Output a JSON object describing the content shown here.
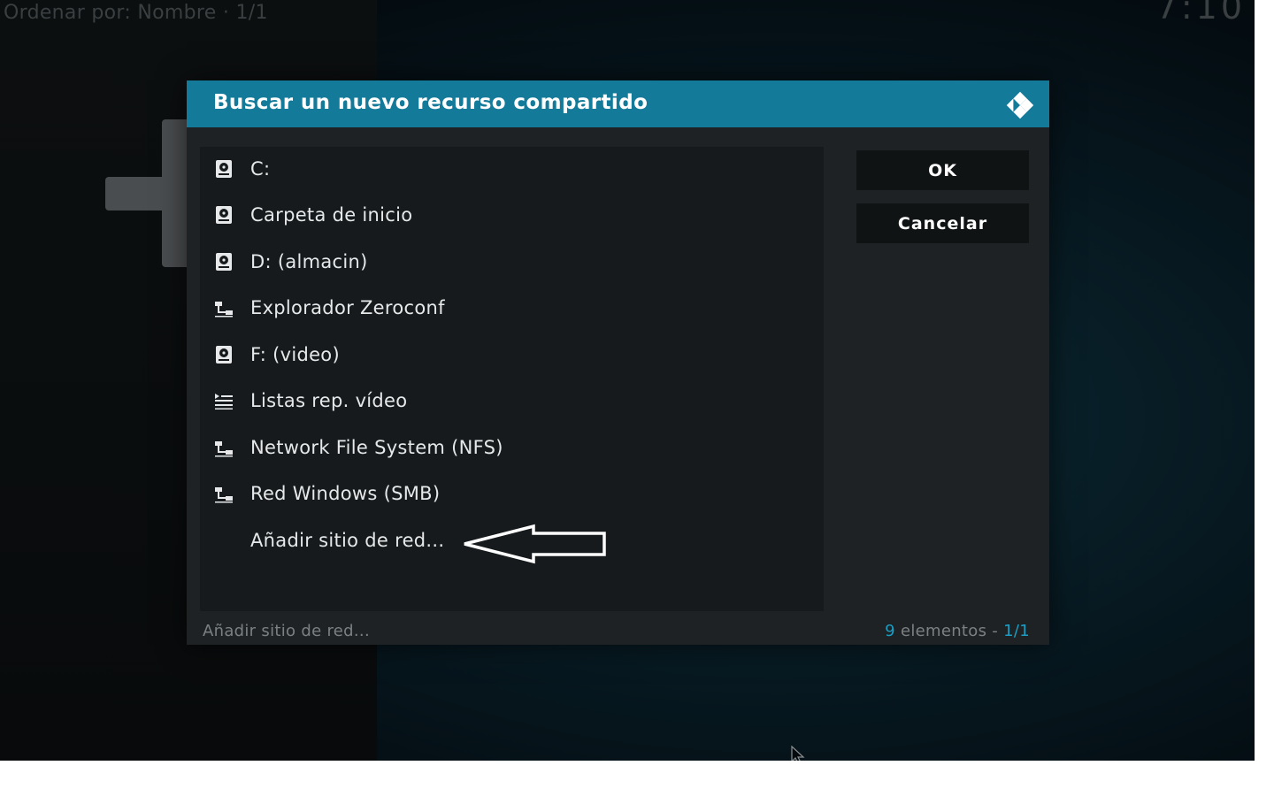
{
  "background": {
    "sort_label": "Ordenar por: Nombre",
    "sort_separator": "·",
    "sort_page": "1/1",
    "clock": "7:10"
  },
  "dialog": {
    "title": "Buscar un nuevo recurso compartido",
    "logo_icon": "kodi-logo-icon",
    "items": [
      {
        "label": "C:",
        "icon": "hard-drive-icon"
      },
      {
        "label": "Carpeta de inicio",
        "icon": "hard-drive-icon"
      },
      {
        "label": "D: (almacin)",
        "icon": "hard-drive-icon"
      },
      {
        "label": "Explorador Zeroconf",
        "icon": "network-icon"
      },
      {
        "label": "F: (video)",
        "icon": "hard-drive-icon"
      },
      {
        "label": "Listas rep. vídeo",
        "icon": "playlist-icon"
      },
      {
        "label": "Network File System (NFS)",
        "icon": "network-icon"
      },
      {
        "label": "Red Windows (SMB)",
        "icon": "network-icon"
      },
      {
        "label": "Añadir sitio de red...",
        "icon": ""
      }
    ],
    "buttons": {
      "ok": "OK",
      "cancel": "Cancelar"
    },
    "footer": {
      "hint": "Añadir sitio de red...",
      "count_number": "9",
      "count_label": " elementos - ",
      "count_page": "1/1"
    }
  },
  "colors": {
    "accent": "#137a99",
    "accent_text": "#1a9ec4",
    "dialog_bg": "#1e2224",
    "list_bg": "#161a1c"
  }
}
